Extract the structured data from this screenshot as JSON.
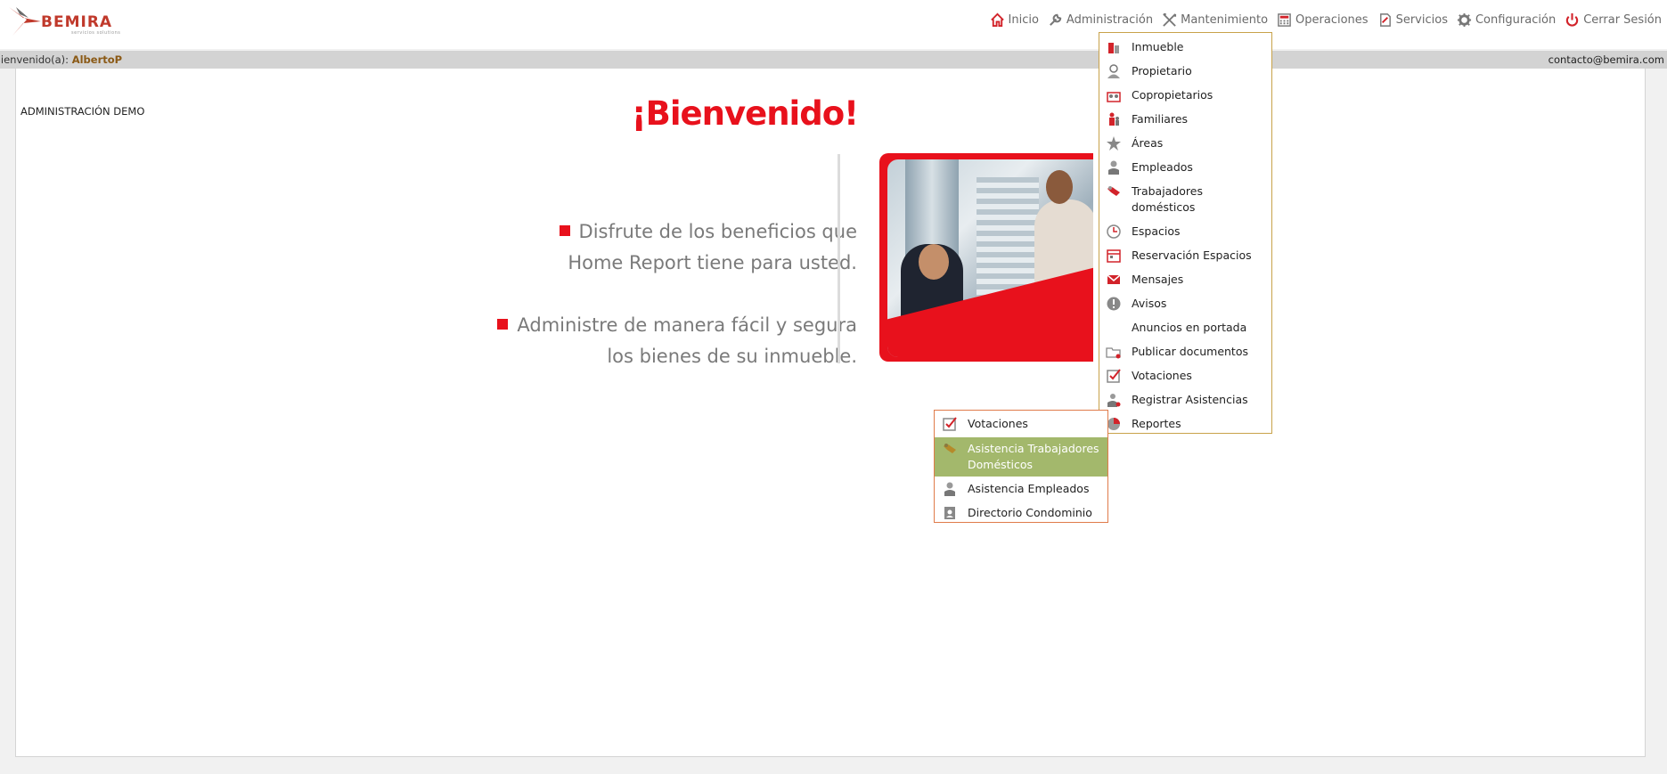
{
  "brand": {
    "name": "BEMIRA",
    "tagline": "servicios solutions"
  },
  "topnav": [
    {
      "label": "Inicio",
      "icon": "home-icon"
    },
    {
      "label": "Administración",
      "icon": "wrench-icon"
    },
    {
      "label": "Mantenimiento",
      "icon": "tools-icon"
    },
    {
      "label": "Operaciones",
      "icon": "calculator-icon"
    },
    {
      "label": "Servicios",
      "icon": "document-icon"
    },
    {
      "label": "Configuración",
      "icon": "gear-icon"
    },
    {
      "label": "Cerrar Sesión",
      "icon": "power-icon"
    }
  ],
  "welcome": {
    "prefix": "Bienvenido(a):",
    "user": "AlbertoP",
    "email": "contacto@bemira.com"
  },
  "page": {
    "admin_title": "ADMINISTRACIÓN DEMO"
  },
  "hero": {
    "title": "¡Bienvenido!",
    "bullet1_line1": "Disfrute de los beneficios que",
    "bullet1_line2": "Home Report tiene para usted.",
    "bullet2_line1": "Administre de manera fácil y segura",
    "bullet2_line2": "los bienes de su inmueble."
  },
  "admin_menu": [
    {
      "label": "Inmueble",
      "icon": "building-icon"
    },
    {
      "label": "Propietario",
      "icon": "owner-icon"
    },
    {
      "label": "Copropietarios",
      "icon": "co-owners-icon"
    },
    {
      "label": "Familiares",
      "icon": "family-icon"
    },
    {
      "label": "Áreas",
      "icon": "star-icon"
    },
    {
      "label": "Empleados",
      "icon": "employee-icon"
    },
    {
      "label": "Trabajadores domésticos",
      "icon": "domestic-worker-icon"
    },
    {
      "label": "Espacios",
      "icon": "clock-icon"
    },
    {
      "label": "Reservación Espacios",
      "icon": "reservation-icon"
    },
    {
      "label": "Mensajes",
      "icon": "mail-icon"
    },
    {
      "label": "Avisos",
      "icon": "alert-icon"
    },
    {
      "label": "Anuncios en portada",
      "icon": ""
    },
    {
      "label": "Publicar documentos",
      "icon": "folder-icon"
    },
    {
      "label": "Votaciones",
      "icon": "checkbox-icon"
    },
    {
      "label": "Registrar Asistencias",
      "icon": "attendance-icon"
    },
    {
      "label": "Reportes",
      "icon": "chart-icon"
    }
  ],
  "sub_menu": [
    {
      "label": "Votaciones",
      "icon": "checkbox-icon"
    },
    {
      "label": "Asistencia Trabajadores Domésticos",
      "icon": "domestic-worker-icon"
    },
    {
      "label": "Asistencia Empleados",
      "icon": "employee-icon"
    },
    {
      "label": "Directorio Condominio",
      "icon": "directory-icon"
    }
  ],
  "colors": {
    "brand_red": "#e8111c",
    "menu_border": "#c8a24a",
    "submenu_active": "#a3b86c",
    "user_name": "#8b5a16"
  }
}
